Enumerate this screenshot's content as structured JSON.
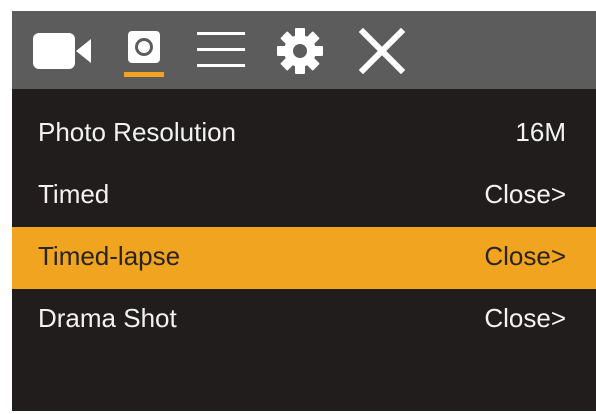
{
  "toolbar": {
    "icons": [
      {
        "name": "video-camera-icon",
        "active": false
      },
      {
        "name": "photo-mode-icon",
        "active": true
      },
      {
        "name": "menu-list-icon",
        "active": false
      },
      {
        "name": "gear-icon",
        "active": false
      },
      {
        "name": "close-icon",
        "active": false
      }
    ],
    "active_color": "#f0a41f"
  },
  "menu": {
    "items": [
      {
        "label": "Photo Resolution",
        "value": "16M",
        "selected": false
      },
      {
        "label": "Timed",
        "value": "Close>",
        "selected": false
      },
      {
        "label": "Timed-lapse",
        "value": "Close>",
        "selected": true
      },
      {
        "label": "Drama Shot",
        "value": "Close>",
        "selected": false
      }
    ]
  },
  "colors": {
    "background": "#201d1c",
    "toolbar": "#5c5c5c",
    "highlight": "#f0a41f",
    "text": "#f2f2f2"
  }
}
